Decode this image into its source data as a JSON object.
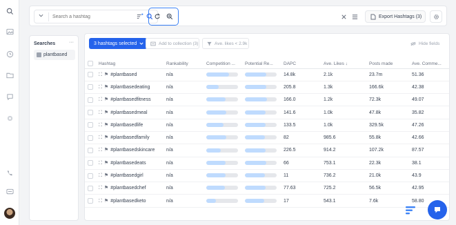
{
  "sidebar": {
    "icons": [
      "search-icon",
      "image-icon",
      "clock-icon",
      "folder-icon",
      "chat-icon",
      "settings-icon",
      "phone-icon",
      "message-icon"
    ]
  },
  "topbar": {
    "search_placeholder": "Search a hashtag",
    "export_label": "Export Hashtags (3)"
  },
  "searches": {
    "title": "Searches",
    "more": "···",
    "items": [
      {
        "label": "plantbased"
      }
    ]
  },
  "toolbar": {
    "selected_label": "3 hashtags selected",
    "add_collection_label": "Add to collection (3)",
    "filter_label": "Ave. likes < 2.9k",
    "hide_fields_label": "Hide fields"
  },
  "table": {
    "headers": [
      "Hashtag",
      "Rankability",
      "Competition ...",
      "Potential Re...",
      "DAPC",
      "Ave. Likes ↓",
      "Posts made",
      "Ave. Comme..."
    ],
    "rows": [
      {
        "hashtag": "#plantbased",
        "rank": "n/a",
        "comp": 0.72,
        "pot": 0.68,
        "dapc": "14.8k",
        "likes": "2.1k",
        "posts": "23.7m",
        "comments": "51.36"
      },
      {
        "hashtag": "#plantbasedeating",
        "rank": "n/a",
        "comp": 0.4,
        "pot": 0.68,
        "dapc": "205.8",
        "likes": "1.3k",
        "posts": "166.6k",
        "comments": "42.38"
      },
      {
        "hashtag": "#plantbasedfitness",
        "rank": "n/a",
        "comp": 0.6,
        "pot": 0.7,
        "dapc": "166.0",
        "likes": "1.2k",
        "posts": "72.3k",
        "comments": "49.07"
      },
      {
        "hashtag": "#plantbasedmeal",
        "rank": "n/a",
        "comp": 0.62,
        "pot": 0.66,
        "dapc": "141.6",
        "likes": "1.0k",
        "posts": "47.8k",
        "comments": "35.82"
      },
      {
        "hashtag": "#plantbasedlife",
        "rank": "n/a",
        "comp": 0.55,
        "pot": 0.66,
        "dapc": "133.5",
        "likes": "1.0k",
        "posts": "329.5k",
        "comments": "47.26"
      },
      {
        "hashtag": "#plantbasedfamily",
        "rank": "n/a",
        "comp": 0.62,
        "pot": 0.64,
        "dapc": "82",
        "likes": "985.6",
        "posts": "55.8k",
        "comments": "42.66"
      },
      {
        "hashtag": "#plantbasedskincare",
        "rank": "n/a",
        "comp": 0.45,
        "pot": 0.66,
        "dapc": "226.5",
        "likes": "914.2",
        "posts": "107.2k",
        "comments": "87.57"
      },
      {
        "hashtag": "#plantbasedeats",
        "rank": "n/a",
        "comp": 0.6,
        "pot": 0.68,
        "dapc": "66",
        "likes": "753.1",
        "posts": "22.3k",
        "comments": "38.1"
      },
      {
        "hashtag": "#plantbasedgirl",
        "rank": "n/a",
        "comp": 0.6,
        "pot": 0.64,
        "dapc": "11",
        "likes": "736.2",
        "posts": "21.0k",
        "comments": "43.9"
      },
      {
        "hashtag": "#plantbasedchef",
        "rank": "n/a",
        "comp": 0.58,
        "pot": 0.66,
        "dapc": "77.63",
        "likes": "725.2",
        "posts": "56.5k",
        "comments": "42.95"
      },
      {
        "hashtag": "#plantbasedketo",
        "rank": "n/a",
        "comp": 0.3,
        "pot": 0.6,
        "dapc": "17",
        "likes": "543.1",
        "posts": "7.6k",
        "comments": "58.80"
      }
    ]
  },
  "colors": {
    "accent": "#2563eb",
    "highlight_border": "#3b82f6",
    "bar_track": "#e5e7eb",
    "bar_fill": "#bfdbfe"
  }
}
